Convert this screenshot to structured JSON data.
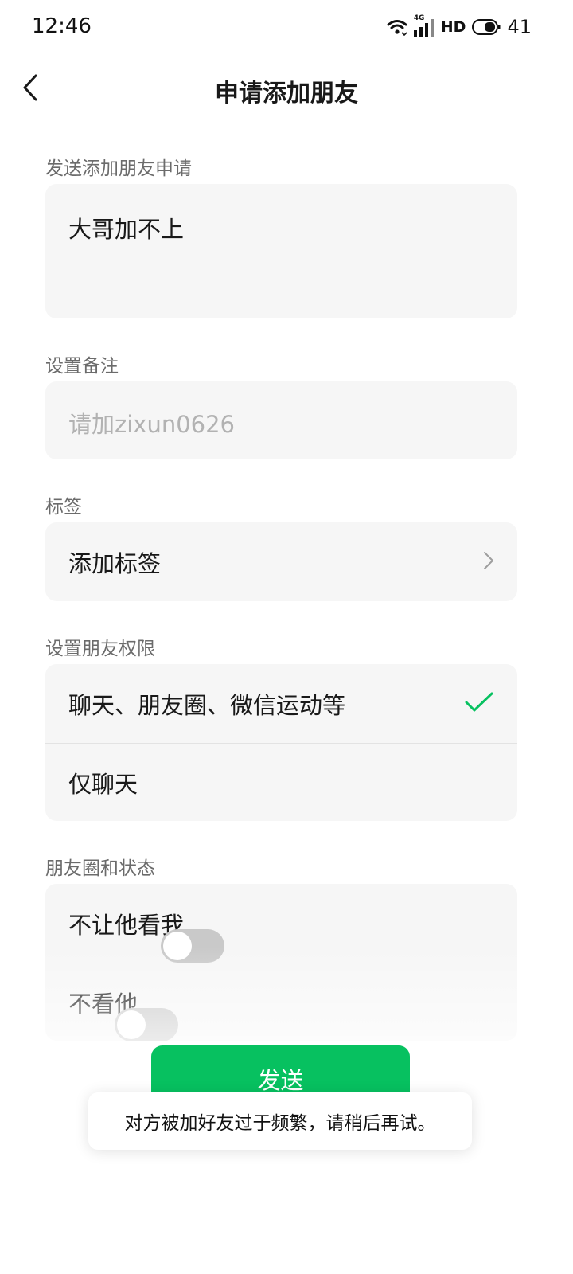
{
  "status_bar": {
    "time": "12:46",
    "network": "4G",
    "hd": "HD",
    "battery": "41"
  },
  "header": {
    "title": "申请添加朋友"
  },
  "request": {
    "label": "发送添加朋友申请",
    "value": "大哥加不上"
  },
  "remark": {
    "label": "设置备注",
    "placeholder": "请加zixun0626"
  },
  "tags": {
    "label": "标签",
    "item": "添加标签"
  },
  "permissions": {
    "label": "设置朋友权限",
    "options": [
      {
        "label": "聊天、朋友圈、微信运动等",
        "selected": true
      },
      {
        "label": "仅聊天",
        "selected": false
      }
    ]
  },
  "moments": {
    "label": "朋友圈和状态",
    "items": [
      {
        "label": "不让他看我",
        "on": false
      },
      {
        "label": "不看他",
        "on": false
      }
    ]
  },
  "send_button": "发送",
  "toast": "对方被加好友过于频繁，请稍后再试。",
  "colors": {
    "accent": "#07c160",
    "card_bg": "#f6f6f6",
    "section_label": "#6b6b6b",
    "placeholder": "#b2b2b2"
  },
  "icons": [
    "back-chevron-icon",
    "wifi-icon",
    "signal-icon",
    "battery-icon",
    "chevron-right-icon",
    "check-icon"
  ]
}
